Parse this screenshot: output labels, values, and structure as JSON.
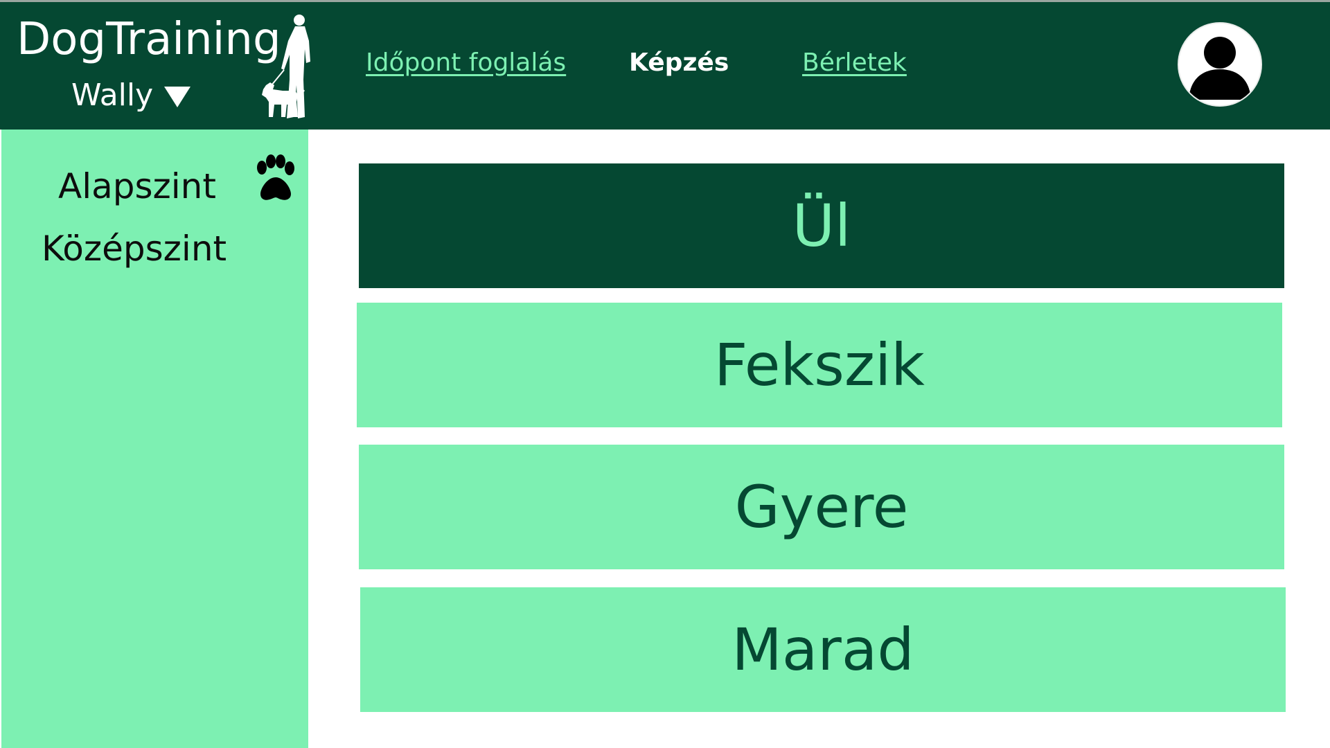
{
  "header": {
    "brand": "DogTraining",
    "dog_selector": {
      "selected": "Wally",
      "caret_icon": "caret-down-icon"
    },
    "logo_icon": "person-walking-dog-icon",
    "nav": [
      {
        "label": "Időpont foglalás",
        "active": false
      },
      {
        "label": "Képzés",
        "active": true
      },
      {
        "label": "Bérletek",
        "active": false
      }
    ],
    "avatar_icon": "user-avatar-icon"
  },
  "sidebar": {
    "items": [
      {
        "label": "Alapszint",
        "selected": true
      },
      {
        "label": "Középszint",
        "selected": false
      }
    ],
    "selected_marker_icon": "paw-icon"
  },
  "exercises": [
    {
      "label": "Ül",
      "active": true
    },
    {
      "label": "Fekszik",
      "active": false
    },
    {
      "label": "Gyere",
      "active": false
    },
    {
      "label": "Marad",
      "active": false
    }
  ],
  "colors": {
    "dark_green": "#054832",
    "mint": "#7df0b2",
    "white": "#ffffff"
  }
}
